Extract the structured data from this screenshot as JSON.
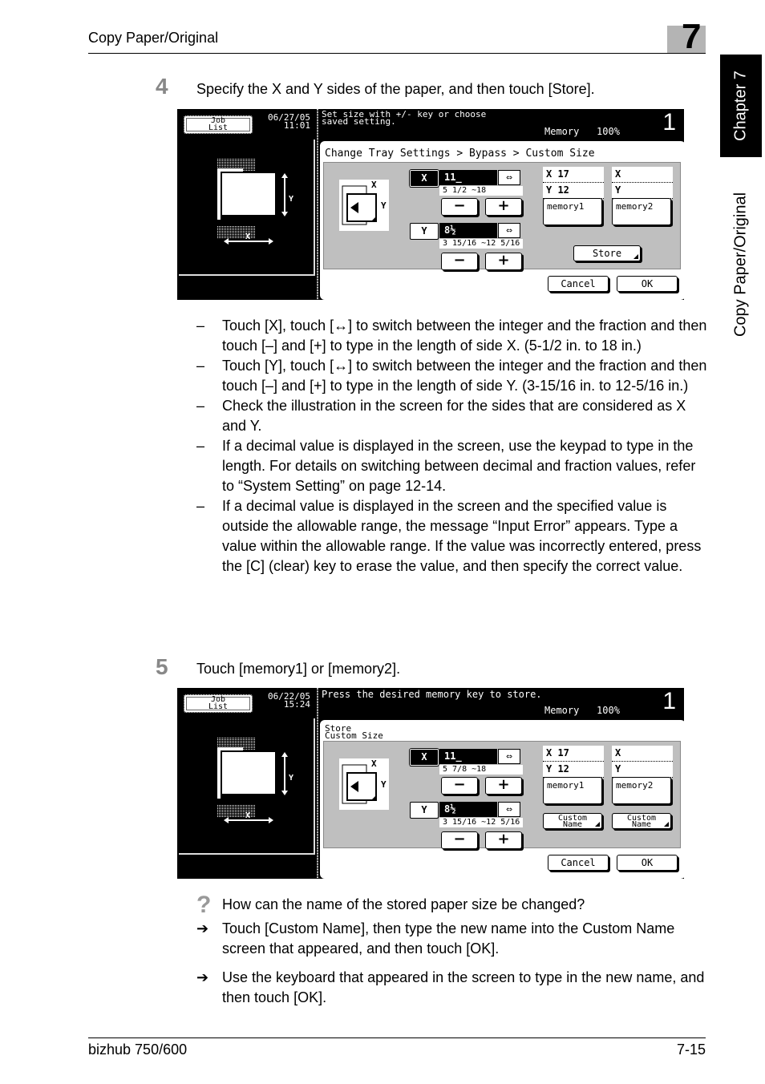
{
  "header": {
    "section_title": "Copy Paper/Original",
    "chapter_number": "7"
  },
  "side_tabs": {
    "chapter": "Chapter 7",
    "section": "Copy Paper/Original"
  },
  "step4": {
    "number": "4",
    "text": "Specify the X and Y sides of the paper, and then touch [Store].",
    "screen": {
      "job_list_label_1": "Job",
      "job_list_label_2": "List",
      "date": "06/27/05",
      "time": "11:01",
      "message_1": "Set size with +/- key or choose",
      "message_2": "saved setting.",
      "memory_label": "Memory",
      "memory_value": "100%",
      "copies": "1",
      "breadcrumb": "Change Tray Settings > Bypass > Custom Size",
      "x_tab": "X",
      "x_value": "11_",
      "x_range": "5 1/2 ~18",
      "y_tab": "Y",
      "y_value": "8½",
      "y_range": "3 15/16 ~12 5/16",
      "swap_glyph": "⇔",
      "minus": "−",
      "plus": "+",
      "illus_x": "X",
      "illus_y": "Y",
      "memory1": {
        "x": "X 17",
        "y": "Y 12",
        "label": "memory1"
      },
      "memory2": {
        "x": "X",
        "y": "Y",
        "label": "memory2"
      },
      "store": "Store",
      "cancel": "Cancel",
      "ok": "OK"
    },
    "bullets": [
      "Touch [X], touch [↔] to switch between the integer and the fraction and then touch [–] and [+] to type in the length of side X. (5-1/2 in. to 18 in.)",
      "Touch [Y], touch [↔] to switch between the integer and the fraction and then touch [–] and [+] to type in the length of side Y. (3-15/16 in. to 12-5/16 in.)",
      "Check the illustration in the screen for the sides that are considered as X and Y.",
      "If a decimal value is displayed in the screen, use the keypad to type in the length. For details on switching between decimal and fraction values, refer to “System Setting” on page 12-14.",
      "If a decimal value is displayed in the screen and the specified value is outside the allowable range, the message “Input Error” appears. Type a value within the allowable range. If the value was incorrectly entered, press the [C] (clear) key to erase the value, and then specify the correct value."
    ],
    "dash": "–"
  },
  "step5": {
    "number": "5",
    "text": "Touch [memory1] or [memory2].",
    "screen": {
      "job_list_label_1": "Job",
      "job_list_label_2": "List",
      "date": "06/22/05",
      "time": "15:24",
      "message_1": "Press the desired memory key to store.",
      "memory_label": "Memory",
      "memory_value": "100%",
      "copies": "1",
      "title_1": "Store",
      "title_2": "Custom Size",
      "x_tab": "X",
      "x_value": "11_",
      "x_range": "5 7/8 ~18",
      "y_tab": "Y",
      "y_value": "8½",
      "y_range": "3 15/16 ~12 5/16",
      "swap_glyph": "⇔",
      "minus": "−",
      "plus": "+",
      "illus_x": "X",
      "illus_y": "Y",
      "memory1": {
        "x": "X 17",
        "y": "Y 12",
        "label": "memory1"
      },
      "memory2": {
        "x": "X",
        "y": "Y",
        "label": "memory2"
      },
      "custom_name_1": "Custom",
      "custom_name_2": "Name",
      "cancel": "Cancel",
      "ok": "OK"
    }
  },
  "qa": {
    "question_glyph": "?",
    "question": "How can the name of the stored paper size be changed?",
    "arrow_glyph": "➔",
    "answers": [
      "Touch [Custom Name], then type the new name into the Custom Name screen that appeared, and then touch [OK].",
      "Use the keyboard that appeared in the screen to type in the new name, and then touch [OK]."
    ]
  },
  "footer": {
    "model": "bizhub 750/600",
    "page": "7-15"
  }
}
